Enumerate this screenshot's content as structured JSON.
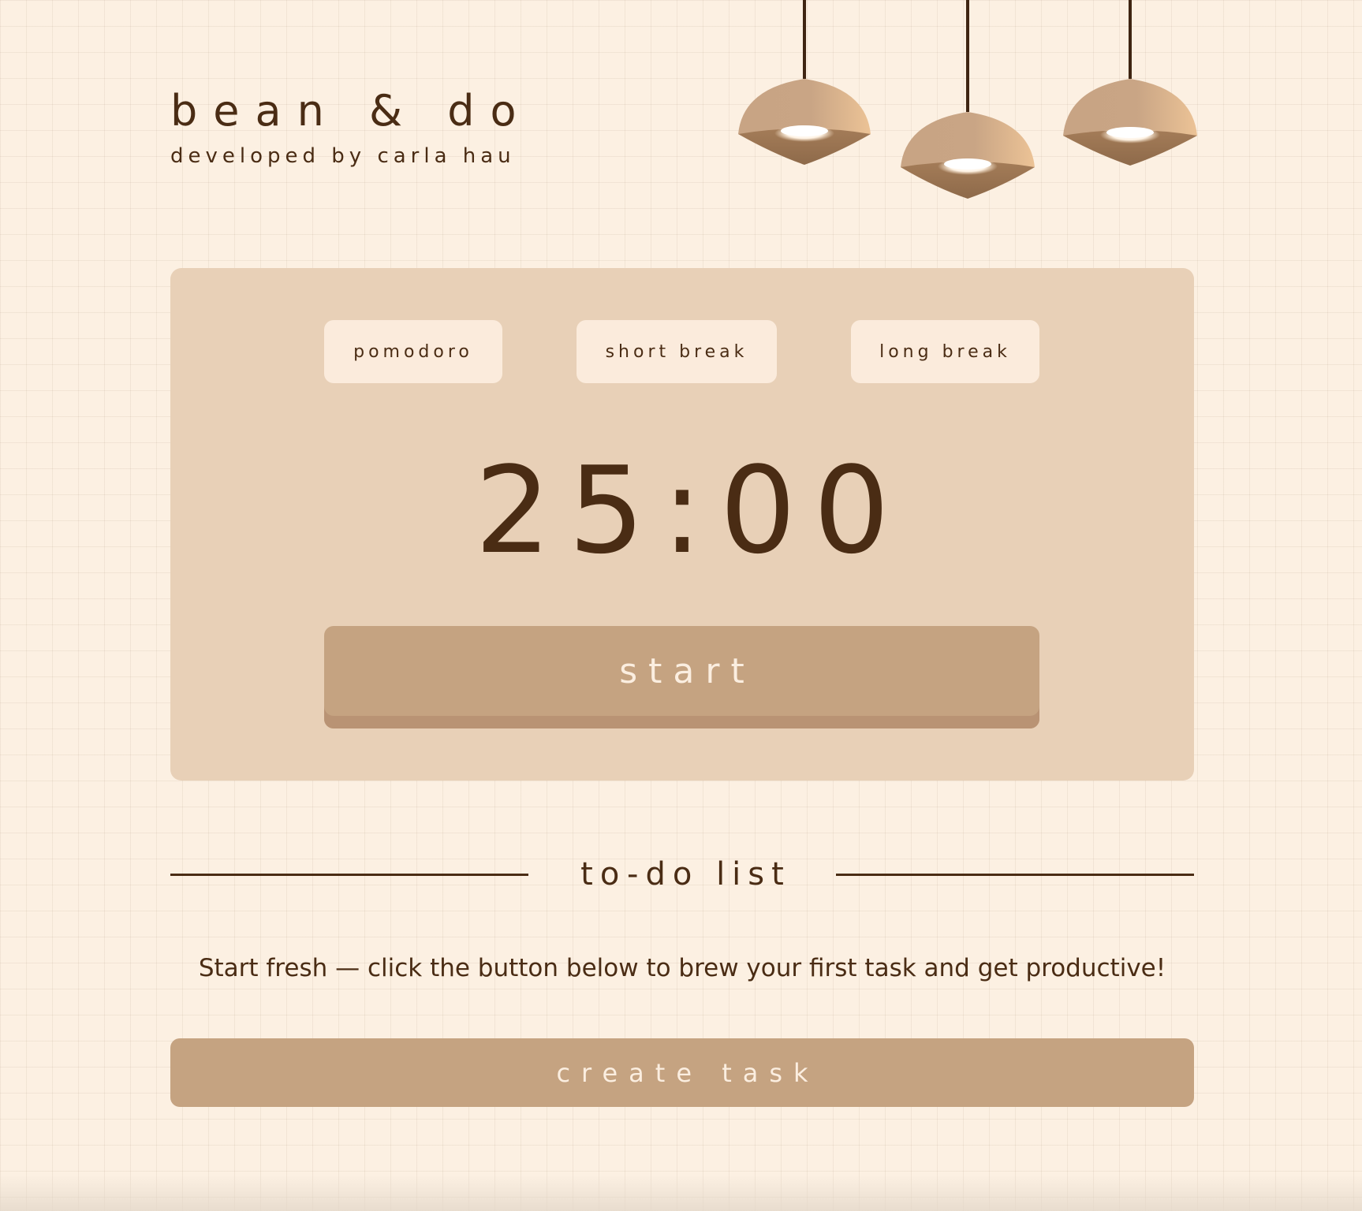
{
  "brand": {
    "title": "bean & do",
    "subtitle": "developed by carla hau"
  },
  "timer": {
    "modes": [
      {
        "label": "pomodoro"
      },
      {
        "label": "short break"
      },
      {
        "label": "long break"
      }
    ],
    "display": "25:00",
    "start_label": "start"
  },
  "todo": {
    "heading": "to-do list",
    "empty_message": "Start fresh — click the button below to brew your first task and get productive!",
    "create_label": "create task"
  },
  "colors": {
    "page_background": "#fcf0e2",
    "panel_background": "#e8d0b7",
    "tab_background": "#fbebdc",
    "button_background": "#c5a381",
    "button_text": "#fbeee0",
    "text_dark_brown": "#4a2c14",
    "lamp_shade": "#c9a585"
  },
  "icons": [
    "pendant-lamp-icon",
    "pendant-lamp-icon",
    "pendant-lamp-icon"
  ]
}
